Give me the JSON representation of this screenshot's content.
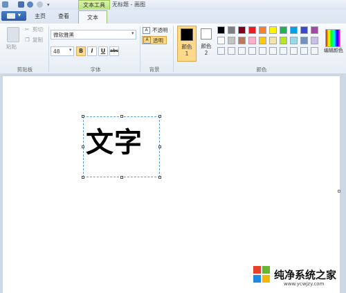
{
  "window": {
    "context_tab": "文本工具",
    "title": "无标题 - 画图"
  },
  "tabs": {
    "home": "主页",
    "view": "查看",
    "text": "文本"
  },
  "clipboard": {
    "paste": "粘贴",
    "cut": "剪切",
    "copy": "复制",
    "group_label": "剪贴板"
  },
  "font": {
    "family": "微软雅黑",
    "size": "48",
    "bold": "B",
    "italic": "I",
    "underline": "U",
    "strike": "abc",
    "group_label": "字体"
  },
  "background": {
    "opaque": "不透明",
    "transparent": "透明",
    "group_label": "背景"
  },
  "colors": {
    "color1_label": "颜色 1",
    "color2_label": "颜色 2",
    "edit_colors": "编辑颜色",
    "group_label": "颜色",
    "color1_value": "#000000",
    "color2_value": "#ffffff",
    "palette_row1": [
      "#000000",
      "#7f7f7f",
      "#880015",
      "#ed1c24",
      "#ff7f27",
      "#fff200",
      "#22b14c",
      "#00a2e8",
      "#3f48cc",
      "#a349a4"
    ],
    "palette_row2": [
      "#ffffff",
      "#c3c3c3",
      "#b97a57",
      "#ffaec9",
      "#ffc90e",
      "#efe4b0",
      "#b5e61d",
      "#99d9ea",
      "#7092be",
      "#c8bfe7"
    ]
  },
  "canvas": {
    "text": "文字"
  },
  "watermark": {
    "brand": "纯净系统之家",
    "url": "www.ycwjzy.com"
  }
}
